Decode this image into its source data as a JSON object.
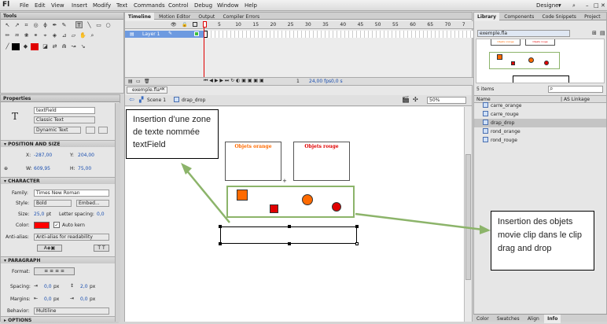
{
  "menubar": {
    "logo": "Fl",
    "items": [
      "File",
      "Edit",
      "View",
      "Insert",
      "Modify",
      "Text",
      "Commands",
      "Control",
      "Debug",
      "Window",
      "Help"
    ],
    "workspace": "Designer"
  },
  "tools_panel": {
    "title": "Tools"
  },
  "timeline": {
    "tabs": [
      "Timeline",
      "Motion Editor",
      "Output",
      "Compiler Errors"
    ],
    "layer": "Layer 1",
    "frame_ticks": [
      "5",
      "10",
      "15",
      "20",
      "25",
      "30",
      "35",
      "40",
      "45",
      "50",
      "55",
      "60",
      "65",
      "70",
      "7"
    ],
    "fps": "24,00 fps",
    "time": "0,0 s",
    "frame": "1"
  },
  "document": {
    "tab": "exemple.fla*",
    "breadcrumb": [
      "Scene 1",
      "drap_drop"
    ],
    "zoom": "50%"
  },
  "properties": {
    "tab": "Properties",
    "instance_name": "textField",
    "text_type": "Classic Text",
    "text_mode": "Dynamic Text",
    "sections": {
      "pos": "POSITION AND SIZE",
      "char": "CHARACTER",
      "para": "PARAGRAPH",
      "opts": "OPTIONS"
    },
    "x_label": "X:",
    "x": "-287,00",
    "y_label": "Y:",
    "y": "204,00",
    "w_label": "W:",
    "w": "609,95",
    "h_label": "H:",
    "h": "75,00",
    "family_label": "Family:",
    "family": "Times New Roman",
    "style_label": "Style:",
    "style": "Bold",
    "embed": "Embed...",
    "size_label": "Size:",
    "size": "25,0",
    "size_unit": "pt",
    "letter_label": "Letter spacing:",
    "letter": "0,0",
    "color_label": "Color:",
    "color": "#ff0000",
    "autokern": "Auto kern",
    "antialias_label": "Anti-alias:",
    "antialias": "Anti-alias for readability",
    "format_label": "Format:",
    "spacing_label": "Spacing:",
    "spacing1": "0,0",
    "spacing2": "2,0",
    "px": "px",
    "margins_label": "Margins:",
    "margin1": "0,0",
    "margin2": "0,0",
    "behavior_label": "Behavior:",
    "behavior": "Multiline"
  },
  "stage": {
    "box_orange_title": "Objets orange",
    "box_red_title": "Objets rouge",
    "callout_left": "Insertion d’une zone de texte nommée textField",
    "callout_right": "Insertion des objets movie clip dans le clip drag and drop",
    "colors": {
      "orange": "#ff6a00",
      "red": "#e00000",
      "green": "#8cb46a"
    }
  },
  "library": {
    "tabs": [
      "Library",
      "Components",
      "Code Snippets",
      "Project"
    ],
    "file": "exemple.fla",
    "count": "5 items",
    "col_name": "Name",
    "col_linkage": "AS Linkage",
    "items": [
      "carre_orange",
      "carre_rouge",
      "drap_drop",
      "rond_orange",
      "rond_rouge"
    ],
    "preview_titles": [
      "Objets orange",
      "Objets rouge"
    ]
  },
  "bottom_tabs": [
    "Color",
    "Swatches",
    "Align",
    "Info"
  ]
}
